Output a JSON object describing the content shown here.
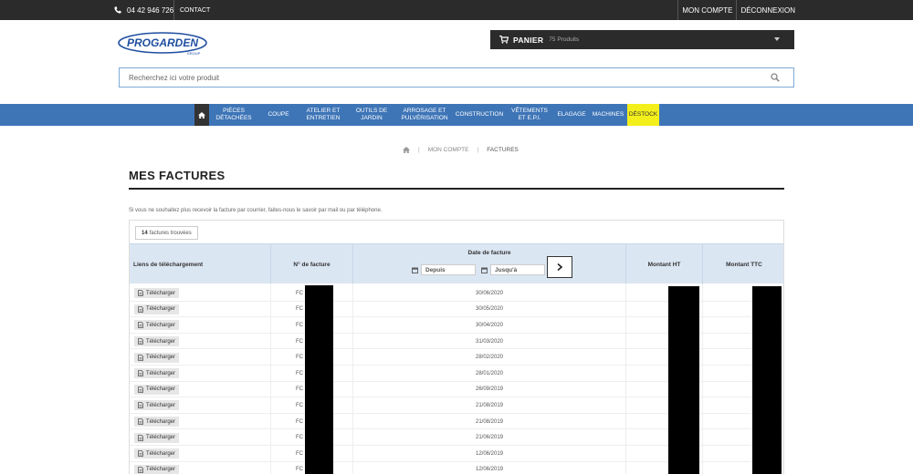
{
  "topbar": {
    "phone": "04 42 946 726",
    "contact": "CONTACT",
    "account": "MON COMPTE",
    "logout": "DÉCONNEXION"
  },
  "header": {
    "logo_text": "PROGARDEN",
    "logo_sub": "GROUP",
    "cart_label": "PANIER",
    "cart_count": "75 Produits",
    "search_placeholder": "Recherchez ici votre produit"
  },
  "nav": {
    "items": [
      "PIÈCES DÉTACHÉES",
      "COUPE",
      "ATELIER ET ENTRETIEN",
      "OUTILS DE JARDIN",
      "ARROSAGE ET PULVÉRISATION",
      "CONSTRUCTION",
      "VÊTEMENTS ET E.P.I.",
      "ELAGAGE",
      "MACHINES",
      "DÉSTOCK"
    ]
  },
  "breadcrumb": {
    "account": "MON COMPTE",
    "current": "FACTURES"
  },
  "page": {
    "title": "MES FACTURES",
    "notice": "Si vous ne souhaitez plus recevoir la facture par courrier, faites-nous le savoir par mail ou par téléphone."
  },
  "table": {
    "found_count": "14",
    "found_label": "factures trouvées",
    "columns": {
      "links": "Liens de téléchargement",
      "invoice_no": "N° de facture",
      "date": "Date de facture",
      "from": "Depuis",
      "to": "Jusqu'à",
      "ht": "Montant HT",
      "ttc": "Montant TTC"
    },
    "download_label": "Télécharger",
    "rows": [
      {
        "prefix": "FC",
        "date": "30/06/2020"
      },
      {
        "prefix": "FC",
        "date": "30/05/2020"
      },
      {
        "prefix": "FC",
        "date": "30/04/2020"
      },
      {
        "prefix": "FC",
        "date": "31/03/2020"
      },
      {
        "prefix": "FC",
        "date": "28/02/2020"
      },
      {
        "prefix": "FC",
        "date": "28/01/2020"
      },
      {
        "prefix": "FC",
        "date": "26/09/2019"
      },
      {
        "prefix": "FC",
        "date": "21/08/2019"
      },
      {
        "prefix": "FC",
        "date": "21/08/2019"
      },
      {
        "prefix": "FC",
        "date": "21/06/2019"
      },
      {
        "prefix": "FC",
        "date": "12/06/2019"
      },
      {
        "prefix": "FC",
        "date": "12/06/2019"
      }
    ]
  }
}
